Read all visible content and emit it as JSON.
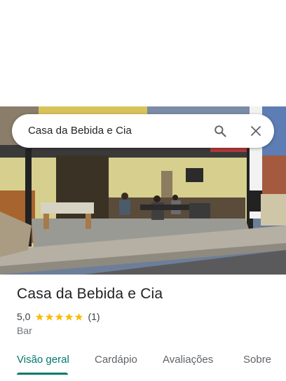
{
  "search": {
    "query": "Casa da Bebida e Cia",
    "search_icon": "search-icon",
    "close_icon": "close-icon"
  },
  "place": {
    "name": "Casa da Bebida e Cia",
    "rating": "5,0",
    "stars": 5,
    "review_count": "(1)",
    "category": "Bar",
    "photo": "storefront-photo"
  },
  "tabs": [
    {
      "label": "Visão geral",
      "active": true
    },
    {
      "label": "Cardápio",
      "active": false
    },
    {
      "label": "Avaliações",
      "active": false
    },
    {
      "label": "Sobre",
      "active": false
    }
  ],
  "colors": {
    "accent": "#00796b",
    "star": "#fbbc04",
    "text": "#202124",
    "secondary_text": "#70757a"
  }
}
